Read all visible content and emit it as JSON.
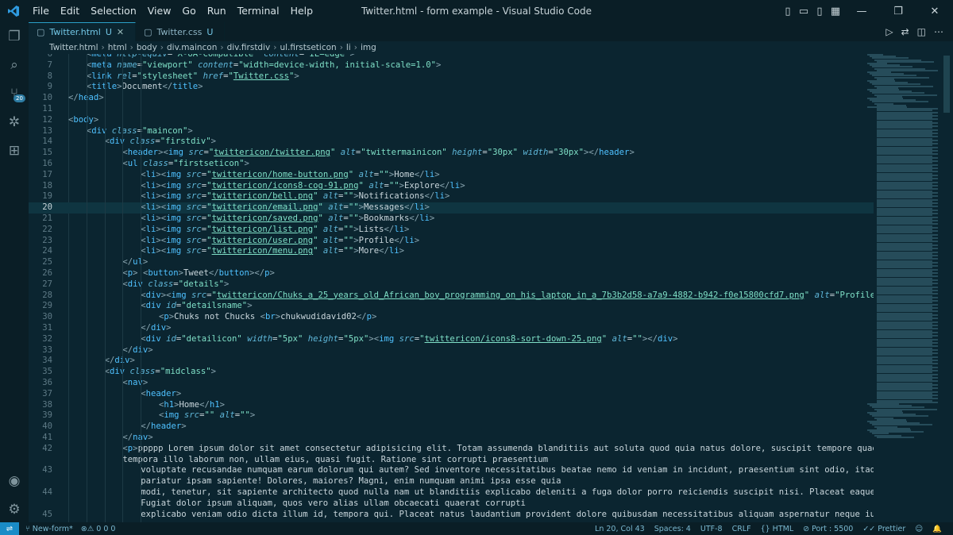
{
  "titlebar": {
    "menu": [
      "File",
      "Edit",
      "Selection",
      "View",
      "Go",
      "Run",
      "Terminal",
      "Help"
    ],
    "window_title": "Twitter.html - form example - Visual Studio Code"
  },
  "activity_bar": {
    "icons": [
      "explorer-icon",
      "search-icon",
      "source-control-icon",
      "debug-icon",
      "extensions-icon",
      "account-icon",
      "settings-icon"
    ],
    "source_control_badge": "20"
  },
  "tabs": [
    {
      "label": "Twitter.html",
      "status": "U",
      "active": true
    },
    {
      "label": "Twitter.css",
      "status": "U",
      "active": false
    }
  ],
  "breadcrumb": [
    "Twitter.html",
    "html",
    "body",
    "div.maincon",
    "div.firstdiv",
    "ul.firstseticon",
    "li",
    "img"
  ],
  "editor": {
    "current_line": 20,
    "lines": [
      {
        "n": "6",
        "indent": 1,
        "html": "<span class=\"br\">&lt;</span><span class=\"t\">meta</span> <span class=\"a\">http-equiv</span>=<span class=\"s\">\"X-UA-Compatible\"</span> <span class=\"a\">content</span>=<span class=\"s\">\"IE=edge\"</span><span class=\"br\">&gt;</span>"
      },
      {
        "n": "7",
        "indent": 1,
        "html": "<span class=\"br\">&lt;</span><span class=\"t\">meta</span> <span class=\"a\">name</span>=<span class=\"s\">\"viewport\"</span> <span class=\"a\">content</span>=<span class=\"s\">\"width=device-width, initial-scale=1.0\"</span><span class=\"br\">&gt;</span>"
      },
      {
        "n": "8",
        "indent": 1,
        "html": "<span class=\"br\">&lt;</span><span class=\"t\">link</span> <span class=\"a\">rel</span>=<span class=\"s\">\"stylesheet\"</span> <span class=\"a\">href</span>=<span class=\"s\">\"</span><span class=\"su\">Twitter.css</span><span class=\"s\">\"</span><span class=\"br\">&gt;</span>"
      },
      {
        "n": "9",
        "indent": 1,
        "html": "<span class=\"br\">&lt;</span><span class=\"t\">title</span><span class=\"br\">&gt;</span>Document<span class=\"br\">&lt;/</span><span class=\"t\">title</span><span class=\"br\">&gt;</span>"
      },
      {
        "n": "10",
        "indent": 0,
        "html": "<span class=\"br\">&lt;/</span><span class=\"t\">head</span><span class=\"br\">&gt;</span>"
      },
      {
        "n": "11",
        "indent": 0,
        "html": ""
      },
      {
        "n": "12",
        "indent": 0,
        "html": "<span class=\"br\">&lt;</span><span class=\"t\">body</span><span class=\"br\">&gt;</span>"
      },
      {
        "n": "13",
        "indent": 1,
        "html": "<span class=\"br\">&lt;</span><span class=\"t\">div</span> <span class=\"a\">class</span>=<span class=\"s\">\"maincon\"</span><span class=\"br\">&gt;</span>"
      },
      {
        "n": "14",
        "indent": 2,
        "html": "<span class=\"br\">&lt;</span><span class=\"t\">div</span> <span class=\"a\">class</span>=<span class=\"s\">\"firstdiv\"</span><span class=\"br\">&gt;</span>"
      },
      {
        "n": "15",
        "indent": 3,
        "html": "<span class=\"br\">&lt;</span><span class=\"t\">header</span><span class=\"br\">&gt;&lt;</span><span class=\"t\">img</span> <span class=\"a\">src</span>=<span class=\"s\">\"</span><span class=\"su\">twittericon/twitter.png</span><span class=\"s\">\"</span> <span class=\"a\">alt</span>=<span class=\"s\">\"twittermainicon\"</span> <span class=\"a\">height</span>=<span class=\"s\">\"30px\"</span> <span class=\"a\">width</span>=<span class=\"s\">\"30px\"</span><span class=\"br\">&gt;&lt;/</span><span class=\"t\">header</span><span class=\"br\">&gt;</span>"
      },
      {
        "n": "16",
        "indent": 3,
        "html": "<span class=\"br\">&lt;</span><span class=\"t\">ul</span> <span class=\"a\">class</span>=<span class=\"s\">\"firstseticon\"</span><span class=\"br\">&gt;</span>"
      },
      {
        "n": "17",
        "indent": 4,
        "html": "<span class=\"br\">&lt;</span><span class=\"t\">li</span><span class=\"br\">&gt;&lt;</span><span class=\"t\">img</span> <span class=\"a\">src</span>=<span class=\"s\">\"</span><span class=\"su\">twittericon/home-button.png</span><span class=\"s\">\"</span> <span class=\"a\">alt</span>=<span class=\"s\">\"\"</span><span class=\"br\">&gt;</span>Home<span class=\"br\">&lt;/</span><span class=\"t\">li</span><span class=\"br\">&gt;</span>"
      },
      {
        "n": "18",
        "indent": 4,
        "html": "<span class=\"br\">&lt;</span><span class=\"t\">li</span><span class=\"br\">&gt;&lt;</span><span class=\"t\">img</span> <span class=\"a\">src</span>=<span class=\"s\">\"</span><span class=\"su\">twittericon/icons8-cog-91.png</span><span class=\"s\">\"</span> <span class=\"a\">alt</span>=<span class=\"s\">\"\"</span><span class=\"br\">&gt;</span>Explore<span class=\"br\">&lt;/</span><span class=\"t\">li</span><span class=\"br\">&gt;</span>"
      },
      {
        "n": "19",
        "indent": 4,
        "html": "<span class=\"br\">&lt;</span><span class=\"t\">li</span><span class=\"br\">&gt;&lt;</span><span class=\"t\">img</span> <span class=\"a\">src</span>=<span class=\"s\">\"</span><span class=\"su\">twittericon/bell.png</span><span class=\"s\">\"</span> <span class=\"a\">alt</span>=<span class=\"s\">\"\"</span><span class=\"br\">&gt;</span>Notifications<span class=\"br\">&lt;/</span><span class=\"t\">li</span><span class=\"br\">&gt;</span>"
      },
      {
        "n": "20",
        "indent": 4,
        "html": "<span class=\"br\">&lt;</span><span class=\"t\">li</span><span class=\"br\">&gt;&lt;</span><span class=\"t\">img</span> <span class=\"a\">src</span>=<span class=\"s\">\"</span><span class=\"su\">twittericon/email.png</span><span class=\"s\">\"</span> <span class=\"a\">alt</span>=<span class=\"s\">\"\"</span><span class=\"br\">&gt;</span>Messages<span class=\"br\">&lt;/</span><span class=\"t\">li</span><span class=\"br\">&gt;</span>"
      },
      {
        "n": "21",
        "indent": 4,
        "html": "<span class=\"br\">&lt;</span><span class=\"t\">li</span><span class=\"br\">&gt;&lt;</span><span class=\"t\">img</span> <span class=\"a\">src</span>=<span class=\"s\">\"</span><span class=\"su\">twittericon/saved.png</span><span class=\"s\">\"</span> <span class=\"a\">alt</span>=<span class=\"s\">\"\"</span><span class=\"br\">&gt;</span>Bookmarks<span class=\"br\">&lt;/</span><span class=\"t\">li</span><span class=\"br\">&gt;</span>"
      },
      {
        "n": "22",
        "indent": 4,
        "html": "<span class=\"br\">&lt;</span><span class=\"t\">li</span><span class=\"br\">&gt;&lt;</span><span class=\"t\">img</span> <span class=\"a\">src</span>=<span class=\"s\">\"</span><span class=\"su\">twittericon/list.png</span><span class=\"s\">\"</span> <span class=\"a\">alt</span>=<span class=\"s\">\"\"</span><span class=\"br\">&gt;</span>Lists<span class=\"br\">&lt;/</span><span class=\"t\">li</span><span class=\"br\">&gt;</span>"
      },
      {
        "n": "23",
        "indent": 4,
        "html": "<span class=\"br\">&lt;</span><span class=\"t\">li</span><span class=\"br\">&gt;&lt;</span><span class=\"t\">img</span> <span class=\"a\">src</span>=<span class=\"s\">\"</span><span class=\"su\">twittericon/user.png</span><span class=\"s\">\"</span> <span class=\"a\">alt</span>=<span class=\"s\">\"\"</span><span class=\"br\">&gt;</span>Profile<span class=\"br\">&lt;/</span><span class=\"t\">li</span><span class=\"br\">&gt;</span>"
      },
      {
        "n": "24",
        "indent": 4,
        "html": "<span class=\"br\">&lt;</span><span class=\"t\">li</span><span class=\"br\">&gt;&lt;</span><span class=\"t\">img</span> <span class=\"a\">src</span>=<span class=\"s\">\"</span><span class=\"su\">twittericon/menu.png</span><span class=\"s\">\"</span> <span class=\"a\">alt</span>=<span class=\"s\">\"\"</span><span class=\"br\">&gt;</span>More<span class=\"br\">&lt;/</span><span class=\"t\">li</span><span class=\"br\">&gt;</span>"
      },
      {
        "n": "25",
        "indent": 3,
        "html": "<span class=\"br\">&lt;/</span><span class=\"t\">ul</span><span class=\"br\">&gt;</span>"
      },
      {
        "n": "26",
        "indent": 3,
        "html": "<span class=\"br\">&lt;</span><span class=\"t\">p</span><span class=\"br\">&gt;</span> <span class=\"br\">&lt;</span><span class=\"t\">button</span><span class=\"br\">&gt;</span>Tweet<span class=\"br\">&lt;/</span><span class=\"t\">button</span><span class=\"br\">&gt;&lt;/</span><span class=\"t\">p</span><span class=\"br\">&gt;</span>"
      },
      {
        "n": "27",
        "indent": 3,
        "html": "<span class=\"br\">&lt;</span><span class=\"t\">div</span> <span class=\"a\">class</span>=<span class=\"s\">\"details\"</span><span class=\"br\">&gt;</span>"
      },
      {
        "n": "28",
        "indent": 4,
        "html": "<span class=\"br\">&lt;</span><span class=\"t\">div</span><span class=\"br\">&gt;&lt;</span><span class=\"t\">img</span> <span class=\"a\">src</span>=<span class=\"s\">\"</span><span class=\"su\">twittericon/Chuks_a_25_years_old_African_boy_programming_on_his_laptop_in_a_7b3b2d58-a7a9-4882-b942-f0e15800cfd7.png</span><span class=\"s\">\"</span> <span class=\"a\">alt</span>=<span class=\"s\">\"Profilepic\"</span><span class=\"br\">&gt;&lt;/</span><span class=\"t\">div</span><span class=\"br\">&gt;</span>"
      },
      {
        "n": "29",
        "indent": 4,
        "html": "<span class=\"br\">&lt;</span><span class=\"t\">div</span> <span class=\"a\">id</span>=<span class=\"s\">\"detailsname\"</span><span class=\"br\">&gt;</span>"
      },
      {
        "n": "30",
        "indent": 5,
        "html": "<span class=\"br\">&lt;</span><span class=\"t\">p</span><span class=\"br\">&gt;</span>Chuks not Chucks <span class=\"br\">&lt;</span><span class=\"t\">br</span><span class=\"br\">&gt;</span>chukwudidavid02<span class=\"br\">&lt;/</span><span class=\"t\">p</span><span class=\"br\">&gt;</span>"
      },
      {
        "n": "31",
        "indent": 4,
        "html": "<span class=\"br\">&lt;/</span><span class=\"t\">div</span><span class=\"br\">&gt;</span>"
      },
      {
        "n": "32",
        "indent": 4,
        "html": "<span class=\"br\">&lt;</span><span class=\"t\">div</span> <span class=\"a\">id</span>=<span class=\"s\">\"detailicon\"</span> <span class=\"a\">width</span>=<span class=\"s\">\"5px\"</span> <span class=\"a\">height</span>=<span class=\"s\">\"5px\"</span><span class=\"br\">&gt;&lt;</span><span class=\"t\">img</span> <span class=\"a\">src</span>=<span class=\"s\">\"</span><span class=\"su\">twittericon/icons8-sort-down-25.png</span><span class=\"s\">\"</span> <span class=\"a\">alt</span>=<span class=\"s\">\"\"</span><span class=\"br\">&gt;&lt;/</span><span class=\"t\">div</span><span class=\"br\">&gt;</span>"
      },
      {
        "n": "33",
        "indent": 3,
        "html": "<span class=\"br\">&lt;/</span><span class=\"t\">div</span><span class=\"br\">&gt;</span>"
      },
      {
        "n": "34",
        "indent": 2,
        "html": "<span class=\"br\">&lt;/</span><span class=\"t\">div</span><span class=\"br\">&gt;</span>"
      },
      {
        "n": "35",
        "indent": 2,
        "html": "<span class=\"br\">&lt;</span><span class=\"t\">div</span> <span class=\"a\">class</span>=<span class=\"s\">\"midclass\"</span><span class=\"br\">&gt;</span>"
      },
      {
        "n": "36",
        "indent": 3,
        "html": "<span class=\"br\">&lt;</span><span class=\"t\">nav</span><span class=\"br\">&gt;</span>"
      },
      {
        "n": "37",
        "indent": 4,
        "html": "<span class=\"br\">&lt;</span><span class=\"t\">header</span><span class=\"br\">&gt;</span>"
      },
      {
        "n": "38",
        "indent": 5,
        "html": "<span class=\"br\">&lt;</span><span class=\"t\">h1</span><span class=\"br\">&gt;</span>Home<span class=\"br\">&lt;/</span><span class=\"t\">h1</span><span class=\"br\">&gt;</span>"
      },
      {
        "n": "39",
        "indent": 5,
        "html": "<span class=\"br\">&lt;</span><span class=\"t\">img</span> <span class=\"a\">src</span>=<span class=\"s\">\"\"</span> <span class=\"a\">alt</span>=<span class=\"s\">\"\"</span><span class=\"br\">&gt;</span>"
      },
      {
        "n": "40",
        "indent": 4,
        "html": "<span class=\"br\">&lt;/</span><span class=\"t\">header</span><span class=\"br\">&gt;</span>"
      },
      {
        "n": "41",
        "indent": 3,
        "html": "<span class=\"br\">&lt;/</span><span class=\"t\">nav</span><span class=\"br\">&gt;</span>"
      },
      {
        "n": "42",
        "indent": 3,
        "html": "<span class=\"br\">&lt;</span><span class=\"t\">p</span><span class=\"br\">&gt;</span>ppppp Lorem ipsum dolor sit amet consectetur adipisicing elit. Totam assumenda blanditiis aut soluta quod quia natus dolore, suscipit tempore quaerat iure qui"
      },
      {
        "n": "",
        "indent": 3,
        "html": "tempora illo laborum non, ullam eius, quasi fugit. Ratione sint corrupti praesentium"
      },
      {
        "n": "43",
        "indent": 4,
        "html": "voluptate recusandae numquam earum dolorum qui autem? Sed inventore necessitatibus beatae nemo id veniam in incidunt, praesentium sint odio, itaque fugiat"
      },
      {
        "n": "",
        "indent": 4,
        "html": "pariatur ipsam sapiente! Dolores, maiores? Magni, enim numquam animi ipsa esse quia"
      },
      {
        "n": "44",
        "indent": 4,
        "html": "modi, tenetur, sit sapiente architecto quod nulla nam ut blanditiis explicabo deleniti a fuga dolor porro reiciendis suscipit nisi. Placeat eaque optio error!"
      },
      {
        "n": "",
        "indent": 4,
        "html": "Fugiat dolor ipsum aliquam, quos vero alias ullam obcaecati quaerat corrupti"
      },
      {
        "n": "45",
        "indent": 4,
        "html": "explicabo veniam odio dicta illum id, tempora qui. Placeat natus laudantium provident dolore quibusdam necessitatibus aliquam aspernatur neque iusto?"
      }
    ]
  },
  "statusbar": {
    "branch": "New-form*",
    "problems": "0 0 0",
    "position": "Ln 20, Col 43",
    "spaces": "Spaces: 4",
    "encoding": "UTF-8",
    "eol": "CRLF",
    "language": "HTML",
    "port": "Port : 5500",
    "prettier": "Prettier"
  }
}
